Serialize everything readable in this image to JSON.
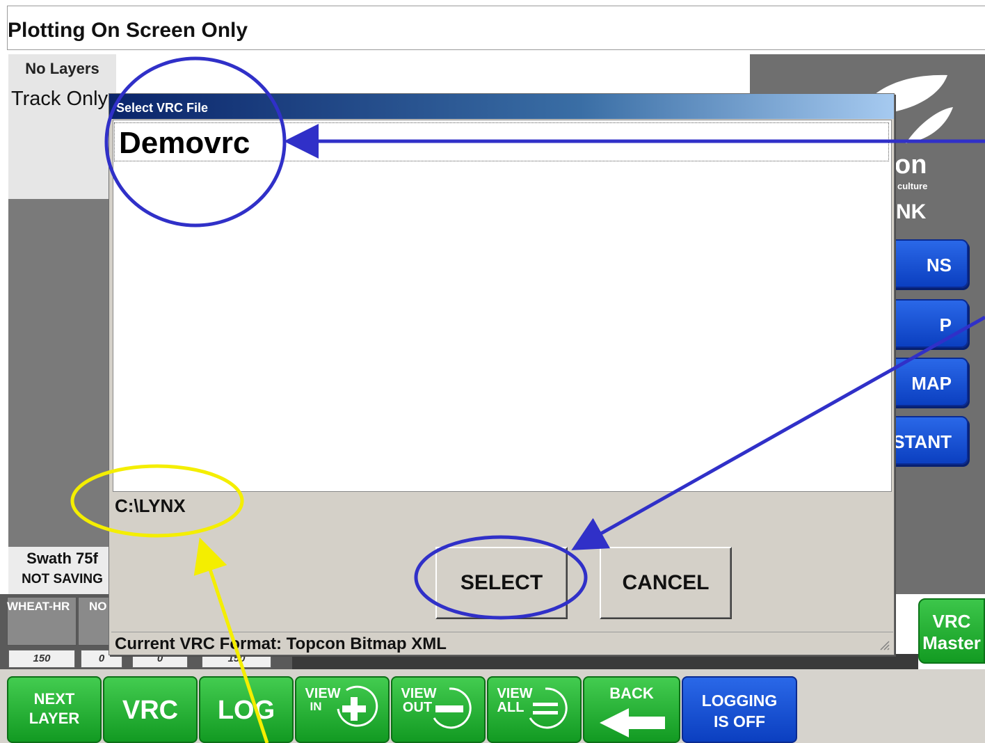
{
  "window": {
    "title": "Plotting On Screen Only"
  },
  "left_panel": {
    "layers_label": "No Layers",
    "track_label": "Track Only",
    "swath": "Swath 75f",
    "saving_status": "NOT SAVING"
  },
  "products": [
    {
      "label": "WHEAT-HR",
      "value": "150"
    },
    {
      "label": "NO",
      "value": "0"
    },
    {
      "label": "",
      "value": "0"
    },
    {
      "label": "",
      "value": "150"
    }
  ],
  "right_panel": {
    "logo_text": "on",
    "logo_sub": "culture",
    "logo_name": "NK",
    "buttons": [
      "NS",
      "P",
      "MAP",
      "STANT"
    ],
    "vrc_master": {
      "line1": "VRC",
      "line2": "Master"
    }
  },
  "dialog": {
    "title": "Select VRC File",
    "files": [
      "Demovrc"
    ],
    "path": "C:\\LYNX",
    "select_label": "SELECT",
    "cancel_label": "CANCEL",
    "status": "Current VRC Format: Topcon Bitmap XML"
  },
  "toolbar": {
    "next_layer": {
      "line1": "NEXT",
      "line2": "LAYER"
    },
    "vrc": "VRC",
    "log": "LOG",
    "view_in": {
      "line1": "VIEW",
      "line2": "IN"
    },
    "view_out": {
      "line1": "VIEW",
      "line2": "OUT"
    },
    "view_all": {
      "line1": "VIEW",
      "line2": "ALL"
    },
    "back": "BACK",
    "logging": {
      "line1": "LOGGING",
      "line2": "IS OFF"
    }
  },
  "colors": {
    "green_button": "#2bb53a",
    "blue_button": "#1a50d8",
    "annotation_blue": "#3030c8",
    "annotation_yellow": "#f4ee00"
  }
}
